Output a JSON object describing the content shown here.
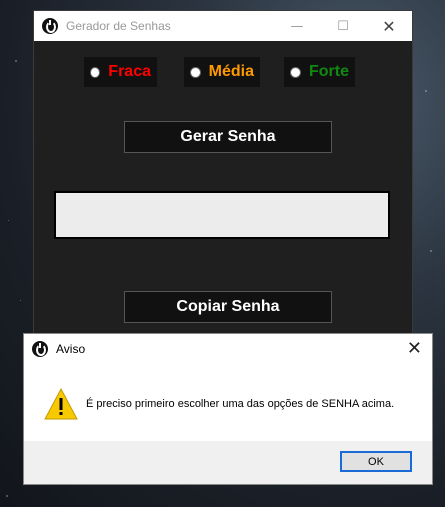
{
  "main_window": {
    "title": "Gerador de Senhas",
    "controls": {
      "minimize": "—",
      "maximize": "☐",
      "close": "✕"
    },
    "strength_options": [
      {
        "label": "Fraca",
        "color": "#ff0000"
      },
      {
        "label": "Média",
        "color": "#ff9900"
      },
      {
        "label": "Forte",
        "color": "#118811"
      }
    ],
    "generate_button": "Gerar Senha",
    "password_value": "",
    "copy_button": "Copiar Senha"
  },
  "dialog": {
    "title": "Aviso",
    "close": "✕",
    "message": "É preciso primeiro escolher uma das opções de SENHA acima.",
    "ok_button": "OK",
    "icon": "warning-icon"
  }
}
